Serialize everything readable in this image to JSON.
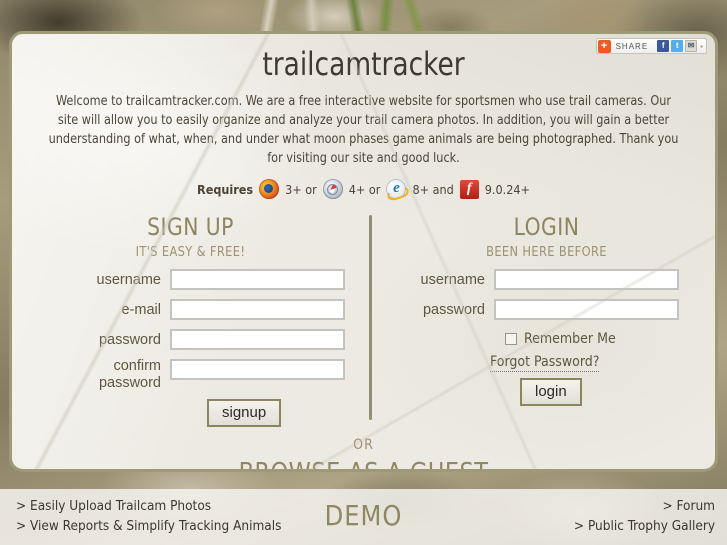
{
  "site": {
    "title": "trailcamtracker",
    "intro": "Welcome to trailcamtracker.com.  We are a free interactive website for sportsmen who use trail cameras.  Our site will allow you to easily organize and analyze your trail camera photos.  In addition, you will gain a better understanding of what, when, and under what moon phases game animals are being photographed.  Thank you for visiting our site and good luck."
  },
  "share": {
    "plus": "+",
    "label": "SHARE",
    "facebook": "f",
    "twitter": "t",
    "email": "✉",
    "more": "▪"
  },
  "requires": {
    "label": "Requires",
    "firefox_version": "3+ or",
    "safari_version": "4+ or",
    "ie_version": "8+ and",
    "ie_glyph": "e",
    "flash_glyph": "f",
    "flash_version": "9.0.24+"
  },
  "signup": {
    "title": "SIGN UP",
    "subtitle": "IT'S EASY & FREE!",
    "username_label": "username",
    "username_value": "",
    "email_label": "e-mail",
    "email_value": "",
    "password_label": "password",
    "password_value": "",
    "confirm_label_line1": "confirm",
    "confirm_label_line2": "password",
    "confirm_value": "",
    "button_label": "signup"
  },
  "login": {
    "title": "LOGIN",
    "subtitle": "BEEN HERE BEFORE",
    "username_label": "username",
    "username_value": "",
    "password_label": "password",
    "password_value": "",
    "remember_label": "Remember Me",
    "remember_checked": false,
    "forgot_label": "Forgot Password?",
    "button_label": "login"
  },
  "guest": {
    "or": "OR",
    "browse_label": "BROWSE AS A GUEST"
  },
  "footer": {
    "left_links": [
      "> Easily Upload Trailcam Photos",
      "> View Reports & Simplify Tracking Animals"
    ],
    "demo_label": "DEMO",
    "right_links": [
      "> Forum",
      "> Public Trophy Gallery"
    ]
  },
  "colors": {
    "panel_bg": "#eceae2",
    "panel_border": "#9d9a78",
    "heading_olive": "#8c8560",
    "text_dark": "#3e3a30",
    "label_brown": "#5d5742",
    "button_border": "#8b8660",
    "input_border": "#c3c3c0",
    "share_orange": "#f05a23",
    "facebook_blue": "#3b5998",
    "twitter_blue": "#55acee"
  }
}
